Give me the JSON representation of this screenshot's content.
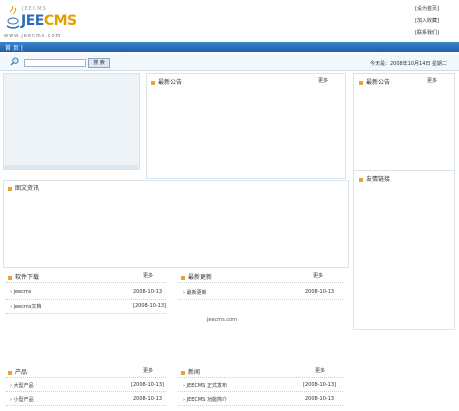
{
  "header": {
    "logo_top": "JEECMS",
    "logo_main_a": "JEE",
    "logo_main_b": "CMS",
    "logo_url": "www.jeecms.com",
    "links": [
      "[设为首页]",
      "[加入收藏]",
      "[联系我们]"
    ]
  },
  "nav": {
    "home": "首 页 |"
  },
  "search": {
    "button": "搜 索",
    "placeholder": ""
  },
  "status": {
    "text": "今天是：2008年10月14日 星期二"
  },
  "panels": {
    "notice_main": {
      "title": "最新公告",
      "more": "更多"
    },
    "notice_side": {
      "title": "最新公告",
      "more": "更多"
    },
    "pic_news": {
      "title": "图文资讯"
    },
    "friend_links": {
      "title": "友情链接"
    },
    "software": {
      "title": "软件下载",
      "more": "更多",
      "rows": [
        {
          "label": "› jeecms",
          "date": "2008-10-13"
        },
        {
          "label": "› jeecms文档",
          "date": "[2008-10-13]"
        }
      ]
    },
    "latest": {
      "title": "最新更新",
      "more": "更多",
      "rows": [
        {
          "label": "› 最新更新",
          "date": "2008-10-13"
        }
      ]
    },
    "center_link": "jeecms.com",
    "products": {
      "title": "产品",
      "more": "更多",
      "rows": [
        {
          "label": "› 大型产品",
          "date": "[2008-10-13]"
        },
        {
          "label": "› 小型产品",
          "date": "2008-10-13"
        }
      ]
    },
    "news": {
      "title": "新闻",
      "more": "更多",
      "rows": [
        {
          "label": "› JEECMS 正式发布",
          "date": "[2008-10-13]"
        },
        {
          "label": "› JEECMS 功能简介",
          "date": "2008-10-13"
        }
      ]
    }
  },
  "colors": {
    "nav": "#1e5fa8",
    "bullet": "#e9a23b",
    "logo_blue": "#2a6dbb",
    "logo_orange": "#e2a000"
  }
}
